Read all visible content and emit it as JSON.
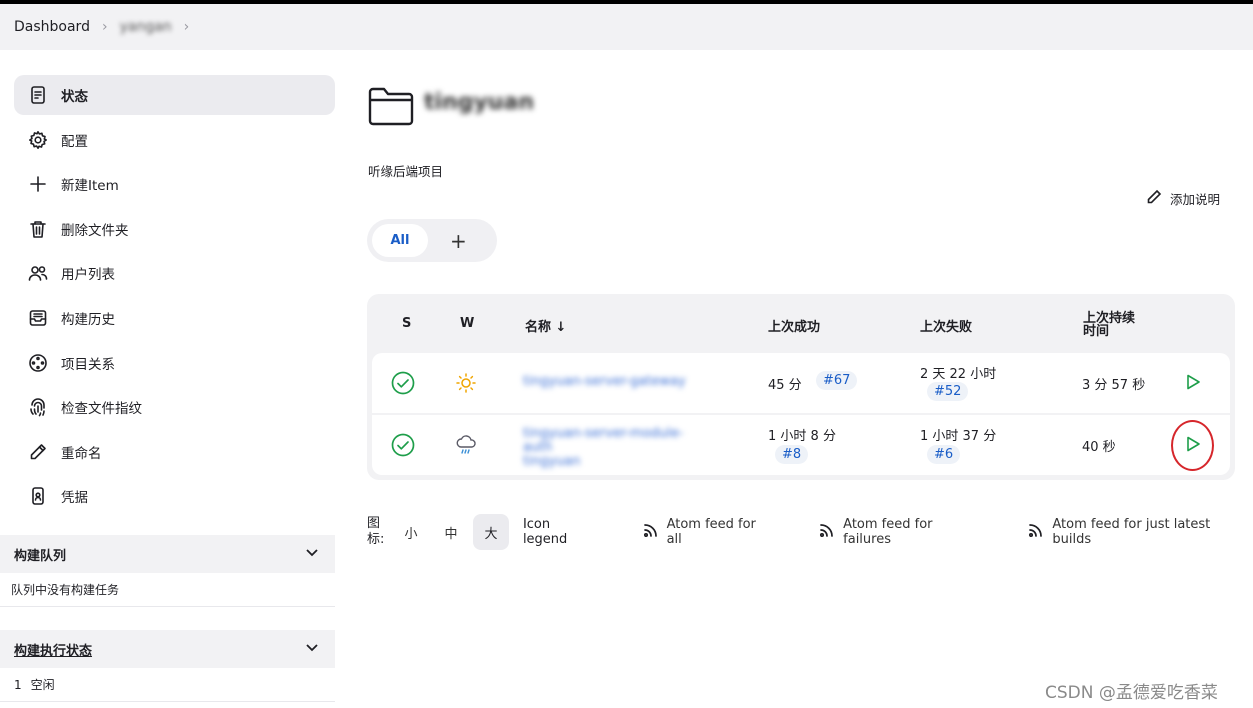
{
  "breadcrumb": {
    "home": "Dashboard",
    "folder": "yangan"
  },
  "sidebar": {
    "items": [
      {
        "label": "状态",
        "icon": "document-icon"
      },
      {
        "label": "配置",
        "icon": "gear-icon"
      },
      {
        "label": "新建Item",
        "icon": "plus-icon"
      },
      {
        "label": "删除文件夹",
        "icon": "trash-icon"
      },
      {
        "label": "用户列表",
        "icon": "users-icon"
      },
      {
        "label": "构建历史",
        "icon": "inbox-icon"
      },
      {
        "label": "项目关系",
        "icon": "relations-icon"
      },
      {
        "label": "检查文件指纹",
        "icon": "fingerprint-icon"
      },
      {
        "label": "重命名",
        "icon": "pencil-icon"
      },
      {
        "label": "凭据",
        "icon": "phone-credentials-icon"
      }
    ],
    "build_queue": {
      "title": "构建队列",
      "empty_text": "队列中没有构建任务"
    },
    "executor_status": {
      "title": "构建执行状态",
      "executor_num": "1",
      "executor_state": "空闲"
    }
  },
  "main": {
    "folder_title": "tingyuan",
    "description": "听缘后端项目",
    "add_description": "添加说明",
    "tabs": {
      "all": "All",
      "add": "+"
    },
    "table": {
      "headers": {
        "s": "S",
        "w": "W",
        "name": "名称 ↓",
        "last_success": "上次成功",
        "last_failure": "上次失败",
        "last_duration_1": "上次持续",
        "last_duration_2": "时间"
      },
      "rows": [
        {
          "name": "tingyuan-server-gateway",
          "weather": "sunny",
          "last_success": "45 分",
          "last_success_build": "#67",
          "last_failure": "2 天 22 小时",
          "last_failure_build": "#52",
          "duration": "3 分 57 秒"
        },
        {
          "name": "tingyuan-server-module-auth",
          "name2": "tingyuan",
          "weather": "rainy",
          "last_success": "1 小时 8 分",
          "last_success_build": "#8",
          "last_failure": "1 小时 37 分",
          "last_failure_build": "#6",
          "duration": "40 秒"
        }
      ]
    },
    "icon_size": {
      "label": "图标:",
      "small": "小",
      "medium": "中",
      "large": "大"
    },
    "icon_legend": "Icon legend",
    "feeds": {
      "all": "Atom feed for all",
      "failures": "Atom feed for failures",
      "latest": "Atom feed for just latest builds"
    }
  },
  "watermark": "CSDN @孟德爱吃香菜",
  "colors": {
    "accent": "#1a5dc7",
    "success": "#1e9e4a",
    "highlight": "#d6262b"
  }
}
